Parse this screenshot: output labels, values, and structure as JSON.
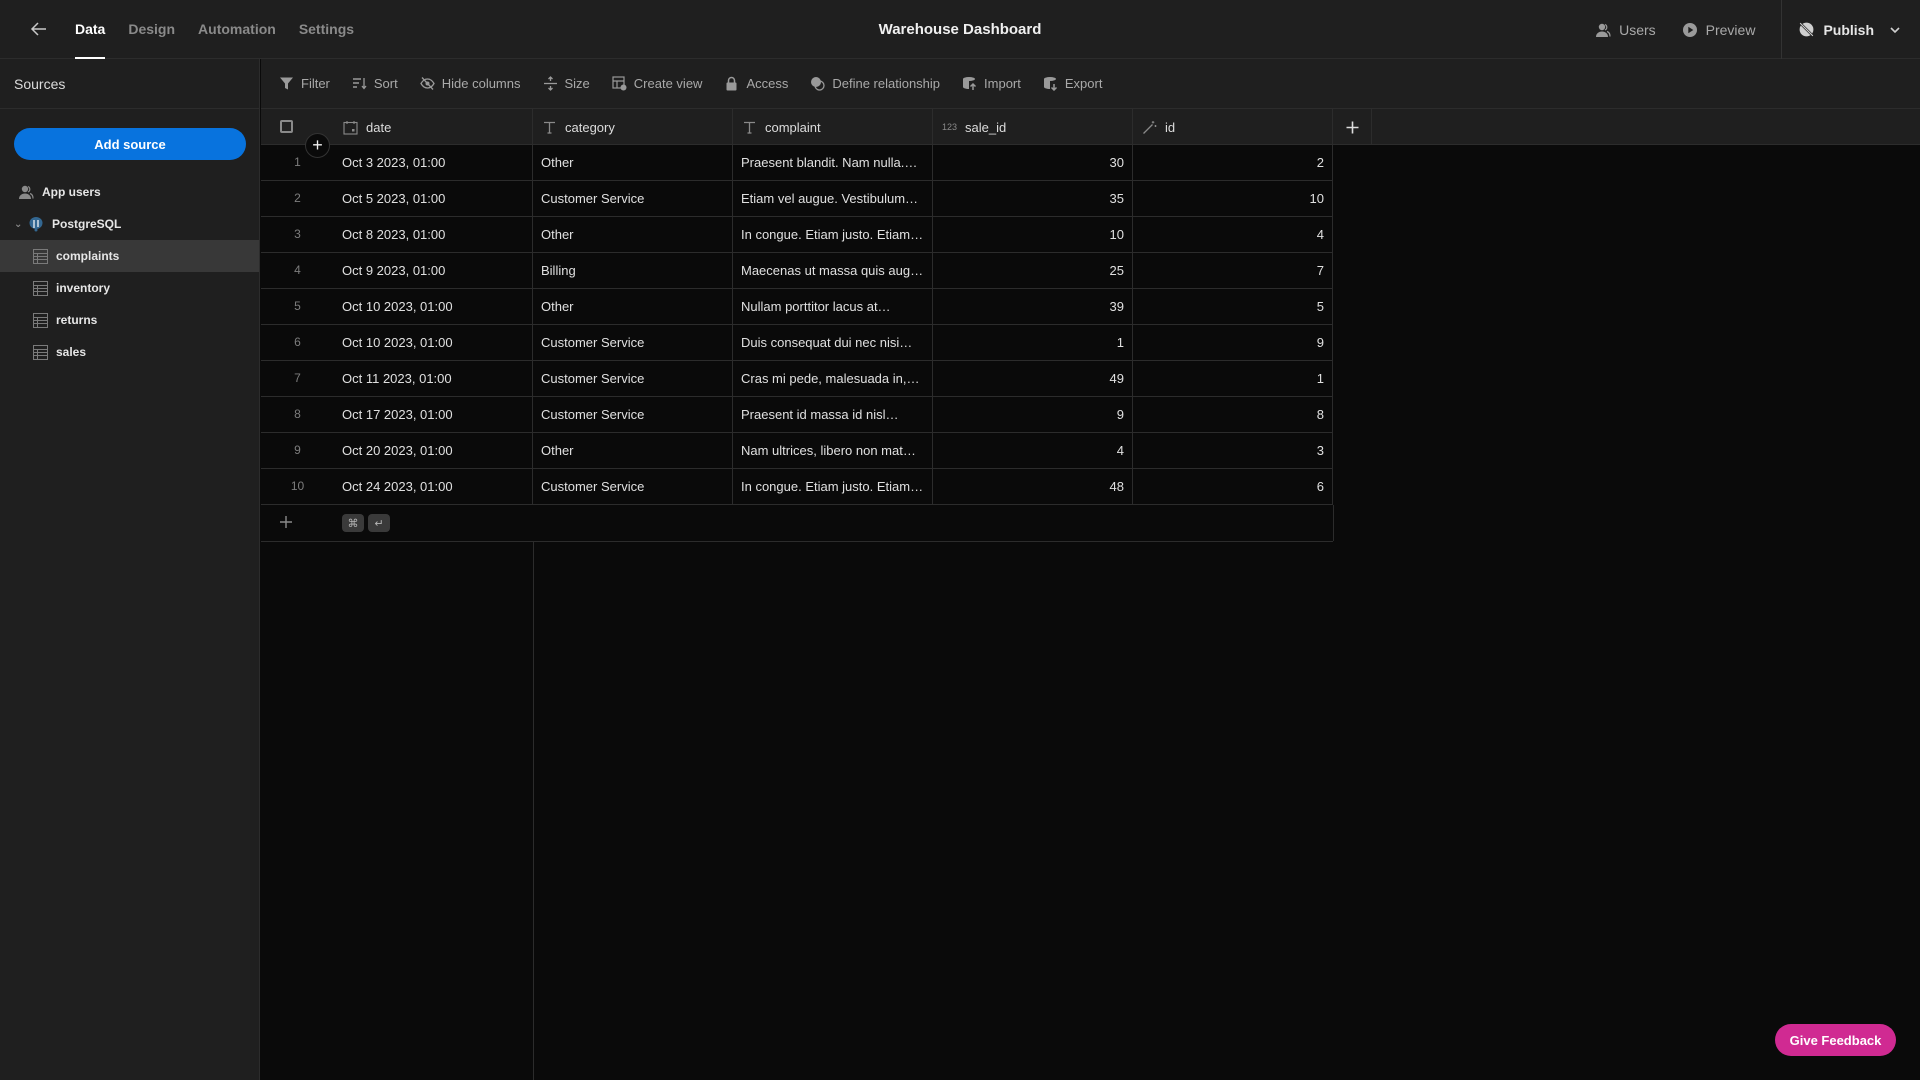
{
  "topbar": {
    "tabs": [
      "Data",
      "Design",
      "Automation",
      "Settings"
    ],
    "active_tab": "Data",
    "app_title": "Warehouse Dashboard",
    "users_label": "Users",
    "preview_label": "Preview",
    "publish_label": "Publish"
  },
  "sidebar": {
    "title": "Sources",
    "add_source_label": "Add source",
    "items": [
      {
        "label": "App users",
        "icon": "users-icon"
      },
      {
        "label": "PostgreSQL",
        "icon": "postgresql-icon",
        "expanded": true
      },
      {
        "label": "complaints",
        "icon": "table-icon",
        "selected": true
      },
      {
        "label": "inventory",
        "icon": "table-icon"
      },
      {
        "label": "returns",
        "icon": "table-icon"
      },
      {
        "label": "sales",
        "icon": "table-icon"
      }
    ]
  },
  "toolbar": {
    "filter": "Filter",
    "sort": "Sort",
    "hide_columns": "Hide columns",
    "size": "Size",
    "create_view": "Create view",
    "access": "Access",
    "define_relationship": "Define relationship",
    "import": "Import",
    "export": "Export"
  },
  "table": {
    "columns": [
      {
        "name": "date",
        "type": "datetime"
      },
      {
        "name": "category",
        "type": "text"
      },
      {
        "name": "complaint",
        "type": "text"
      },
      {
        "name": "sale_id",
        "type": "number",
        "type_badge": "123"
      },
      {
        "name": "id",
        "type": "autoid"
      }
    ],
    "rows": [
      {
        "n": "1",
        "date": "Oct 3 2023, 01:00",
        "category": "Other",
        "complaint": "Praesent blandit. Nam nulla.…",
        "sale_id": "30",
        "id": "2"
      },
      {
        "n": "2",
        "date": "Oct 5 2023, 01:00",
        "category": "Customer Service",
        "complaint": "Etiam vel augue. Vestibulum…",
        "sale_id": "35",
        "id": "10"
      },
      {
        "n": "3",
        "date": "Oct 8 2023, 01:00",
        "category": "Other",
        "complaint": "In congue. Etiam justo. Etiam…",
        "sale_id": "10",
        "id": "4"
      },
      {
        "n": "4",
        "date": "Oct 9 2023, 01:00",
        "category": "Billing",
        "complaint": "Maecenas ut massa quis aug…",
        "sale_id": "25",
        "id": "7"
      },
      {
        "n": "5",
        "date": "Oct 10 2023, 01:00",
        "category": "Other",
        "complaint": "Nullam porttitor lacus at…",
        "sale_id": "39",
        "id": "5"
      },
      {
        "n": "6",
        "date": "Oct 10 2023, 01:00",
        "category": "Customer Service",
        "complaint": "Duis consequat dui nec nisi…",
        "sale_id": "1",
        "id": "9"
      },
      {
        "n": "7",
        "date": "Oct 11 2023, 01:00",
        "category": "Customer Service",
        "complaint": "Cras mi pede, malesuada in,…",
        "sale_id": "49",
        "id": "1"
      },
      {
        "n": "8",
        "date": "Oct 17 2023, 01:00",
        "category": "Customer Service",
        "complaint": "Praesent id massa id nisl…",
        "sale_id": "9",
        "id": "8"
      },
      {
        "n": "9",
        "date": "Oct 20 2023, 01:00",
        "category": "Other",
        "complaint": "Nam ultrices, libero non mat…",
        "sale_id": "4",
        "id": "3"
      },
      {
        "n": "10",
        "date": "Oct 24 2023, 01:00",
        "category": "Customer Service",
        "complaint": "In congue. Etiam justo. Etiam…",
        "sale_id": "48",
        "id": "6"
      }
    ],
    "shortcut_keys": [
      "⌘",
      "↵"
    ]
  },
  "feedback_label": "Give Feedback",
  "colors": {
    "primary": "#0873de",
    "feedback": "#d02a92"
  }
}
